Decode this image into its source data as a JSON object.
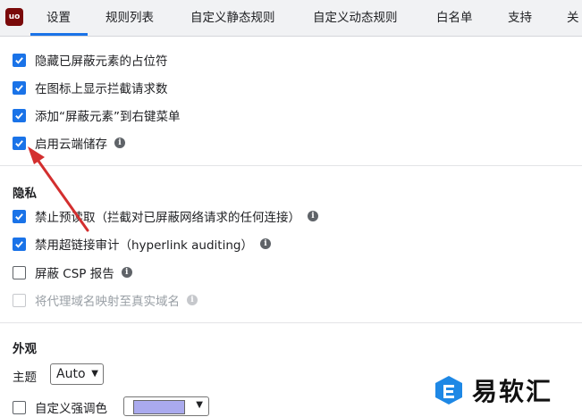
{
  "header": {
    "logo_text": "uo",
    "tabs": [
      {
        "label": "设置",
        "active": true
      },
      {
        "label": "规则列表"
      },
      {
        "label": "自定义静态规则"
      },
      {
        "label": "自定义动态规则"
      },
      {
        "label": "白名单"
      },
      {
        "label": "支持"
      },
      {
        "label": "关"
      }
    ]
  },
  "general": {
    "options": [
      {
        "label": "隐藏已屏蔽元素的占位符",
        "checked": true
      },
      {
        "label": "在图标上显示拦截请求数",
        "checked": true
      },
      {
        "label": "添加“屏蔽元素”到右键菜单",
        "checked": true
      },
      {
        "label": "启用云端储存",
        "checked": true,
        "info": true
      }
    ]
  },
  "privacy": {
    "title": "隐私",
    "options": [
      {
        "label": "禁止预读取（拦截对已屏蔽网络请求的任何连接）",
        "checked": true,
        "info": true
      },
      {
        "label": "禁用超链接审计（hyperlink auditing）",
        "checked": true,
        "info": true
      },
      {
        "label": "屏蔽 CSP 报告",
        "checked": false,
        "info": true
      },
      {
        "label": "将代理域名映射至真实域名",
        "checked": false,
        "disabled": true,
        "info": true
      }
    ]
  },
  "appearance": {
    "title": "外观",
    "theme_label": "主题",
    "theme_value": "Auto",
    "accent_label": "自定义强调色",
    "accent_color": "#aaaaee"
  },
  "colors": {
    "accent": "#1a73e8",
    "arrow": "#d32f2f"
  },
  "watermark": {
    "text": "易软汇"
  }
}
